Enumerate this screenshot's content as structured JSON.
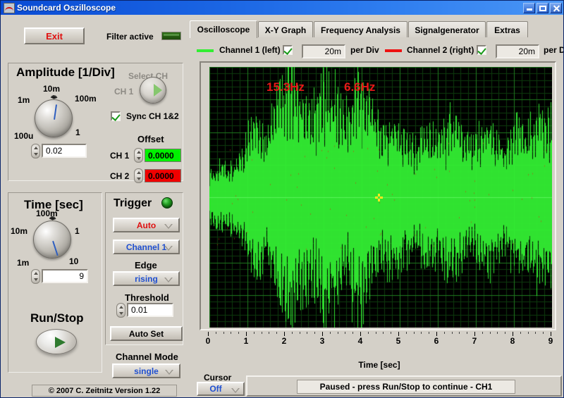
{
  "window": {
    "title": "Soundcard Oszilloscope",
    "icon": "oscilloscope-icon",
    "minimize": "minimize-icon",
    "maximize": "maximize-icon",
    "close": "close-icon"
  },
  "toolbar": {
    "exit_label": "Exit",
    "filter_label": "Filter active"
  },
  "amplitude": {
    "title": "Amplitude [1/Div]",
    "knob_labels": [
      "10m",
      "100m",
      "1",
      "100u",
      "1m"
    ],
    "value": "0.02",
    "select_ch_title": "Select CH",
    "select_ch_value": "CH 1",
    "sync_label": "Sync CH 1&2",
    "sync_checked": true,
    "offset_title": "Offset",
    "ch1_label": "CH 1",
    "ch1_value": "0.0000",
    "ch1_color": "#00f000",
    "ch2_label": "CH 2",
    "ch2_value": "0.0000",
    "ch2_color": "#f00000"
  },
  "time": {
    "title": "Time [sec]",
    "knob_labels": [
      "100m",
      "1",
      "10",
      "1m",
      "10m"
    ],
    "value": "9"
  },
  "runstop": {
    "title": "Run/Stop",
    "icon": "play-icon"
  },
  "trigger": {
    "title": "Trigger",
    "led": "trigger-led",
    "mode_value": "Auto",
    "channel_value": "Channel 1",
    "edge_title": "Edge",
    "edge_value": "rising",
    "threshold_title": "Threshold",
    "threshold_value": "0.01",
    "autoset_label": "Auto Set"
  },
  "channel_mode": {
    "title": "Channel Mode",
    "value": "single"
  },
  "footer": {
    "copyright": "© 2007   C. Zeitnitz Version 1.22"
  },
  "tabs": [
    {
      "label": "Oscilloscope",
      "active": true
    },
    {
      "label": "X-Y Graph",
      "active": false
    },
    {
      "label": "Frequency Analysis",
      "active": false
    },
    {
      "label": "Signalgenerator",
      "active": false
    },
    {
      "label": "Extras",
      "active": false
    }
  ],
  "channels": [
    {
      "name": "Channel 1 (left)",
      "color": "#33ee33",
      "enabled": true,
      "per_div_value": "20m",
      "per_div_label": "per Div"
    },
    {
      "name": "Channel 2 (right)",
      "color": "#ee1111",
      "enabled": true,
      "per_div_value": "20m",
      "per_div_label": "per Div"
    }
  ],
  "plot": {
    "freq_label_1": "15.3Hz",
    "freq_label_2": "6.6Hz",
    "cursor_marker": "cursor-crosshair",
    "background": "#000000",
    "grid_color": "#1f7a1f",
    "trace_color": "#33ee33"
  },
  "status": {
    "cursor_title": "Cursor",
    "cursor_value": "Off",
    "message": "Paused - press Run/Stop to continue - CH1"
  },
  "chart_data": {
    "type": "line",
    "title": "",
    "xlabel": "Time [sec]",
    "ylabel": "",
    "xlim": [
      0,
      9
    ],
    "ylim": [
      -0.1,
      0.1
    ],
    "x_ticks": [
      0,
      1,
      2,
      3,
      4,
      5,
      6,
      7,
      8,
      9
    ],
    "x_tick_labels": [
      "0",
      "1",
      "2",
      "3",
      "4",
      "5",
      "6",
      "7",
      "8",
      "9"
    ],
    "grid": true,
    "divisions_x": 9,
    "divisions_y": 8,
    "volts_per_div": "20m",
    "sec_per_div": "1",
    "annotations": [
      {
        "text": "15.3Hz",
        "x": 1.9,
        "y": 0.082,
        "color": "#e81818"
      },
      {
        "text": "6.6Hz",
        "x": 4.0,
        "y": 0.082,
        "color": "#e81818"
      }
    ],
    "cursor": {
      "x": 4.45,
      "y": 0.0,
      "color": "#ffe820"
    },
    "series": [
      {
        "name": "Channel 1 (left)",
        "color": "#33ee33",
        "description": "Noisy amplitude-modulated burst signal, dense spikes across full 0-9 s window, envelope grows from ~0.25 div near t=0 to ~4 div peaks between t=1.5 and t=5, then settles to ~2 div",
        "envelope_x": [
          0.0,
          0.3,
          0.6,
          0.9,
          1.2,
          1.5,
          1.8,
          2.1,
          2.4,
          2.7,
          3.0,
          3.3,
          3.6,
          3.9,
          4.2,
          4.5,
          4.8,
          5.1,
          5.4,
          5.7,
          6.0,
          6.3,
          6.6,
          6.9,
          7.2,
          7.5,
          7.8,
          8.1,
          8.4,
          8.7,
          9.0
        ],
        "envelope_y": [
          0.012,
          0.02,
          0.018,
          0.026,
          0.05,
          0.03,
          0.062,
          0.072,
          0.055,
          0.048,
          0.068,
          0.06,
          0.045,
          0.07,
          0.052,
          0.038,
          0.044,
          0.036,
          0.03,
          0.04,
          0.034,
          0.046,
          0.038,
          0.032,
          0.042,
          0.036,
          0.03,
          0.044,
          0.038,
          0.05,
          0.042
        ]
      },
      {
        "name": "Channel 2 (right)",
        "color": "#ee1111",
        "description": "Overlaid faint red trace hidden behind Channel 1 trace",
        "envelope_x": [],
        "envelope_y": []
      }
    ]
  }
}
